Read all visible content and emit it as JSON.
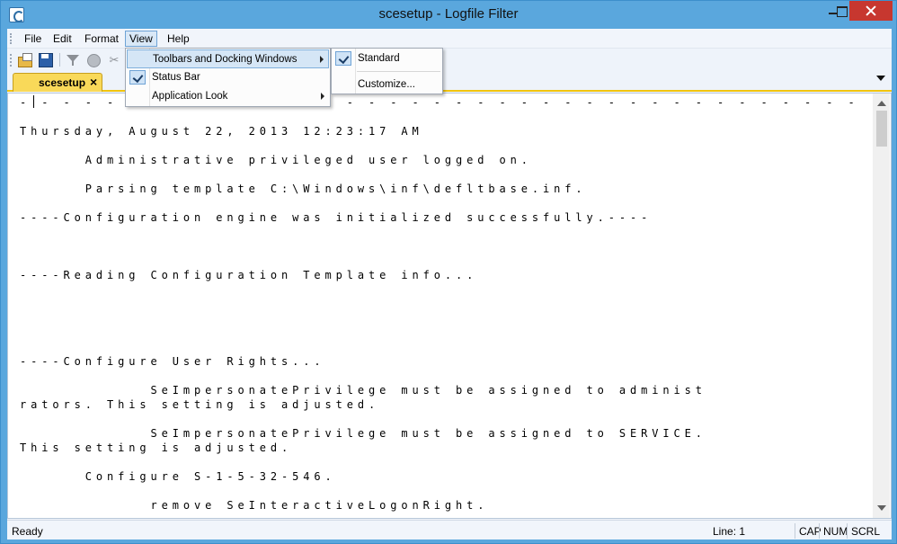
{
  "window": {
    "title": "scesetup - Logfile Filter"
  },
  "menubar": {
    "items": [
      {
        "label": "File"
      },
      {
        "label": "Edit"
      },
      {
        "label": "Format"
      },
      {
        "label": "View"
      },
      {
        "label": "Help"
      }
    ]
  },
  "toolbar": {
    "buttons": [
      "open-icon",
      "save-icon",
      "filter-icon",
      "globe-icon",
      "cut-icon"
    ]
  },
  "tabs": {
    "active": {
      "label": "scesetup",
      "close": "×"
    }
  },
  "view_menu": {
    "items": [
      {
        "label": "Toolbars and Docking Windows",
        "has_submenu": true,
        "checked": false
      },
      {
        "label": "Status Bar",
        "has_submenu": false,
        "checked": true
      },
      {
        "label": "Application Look",
        "has_submenu": true,
        "checked": false
      }
    ]
  },
  "submenu": {
    "items": [
      {
        "label": "Standard",
        "checked": true
      },
      {
        "label": "Customize..."
      }
    ]
  },
  "editor": {
    "lines": [
      "﻿- - - - - - - - - - - - - - - - - - - - - - - - - - - - - - - - - - - - - - - - - - - - - -",
      "Thursday, August 22, 2013 12:23:17 AM",
      "      Administrative privileged user logged on.",
      "      Parsing template C:\\Windows\\inf\\defltbase.inf.",
      "----Configuration engine was initialized successfully.----",
      "",
      "----Reading Configuration Template info...",
      "",
      "",
      "----Configure User Rights...",
      "            SeImpersonatePrivilege must be assigned to administ",
      "rators. This setting is adjusted.",
      "            SeImpersonatePrivilege must be assigned to SERVICE.",
      "This setting is adjusted.",
      "      Configure S-1-5-32-546.",
      "            remove SeInteractiveLogonRight."
    ]
  },
  "statusbar": {
    "ready": "Ready",
    "line": "Line: 1",
    "cap": "CAP",
    "num": "NUM",
    "scrl": "SCRL"
  }
}
